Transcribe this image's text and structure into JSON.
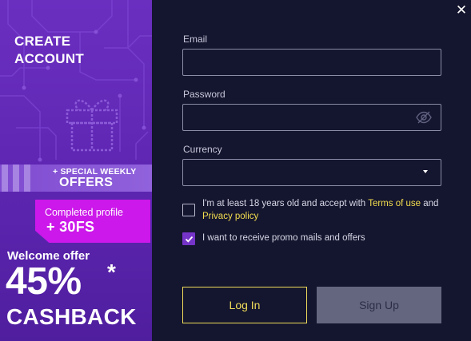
{
  "promo": {
    "title": "CREATE ACCOUNT",
    "weekly_sub": "+ SPECIAL WEEKLY",
    "weekly_main": "OFFERS",
    "profile_sub": "Completed profile",
    "profile_main": "+ 30FS",
    "welcome": "Welcome offer",
    "percent": "45%",
    "asterisk": "*",
    "cashback": "CASHBACK",
    "colors": {
      "panel": "#6027b4",
      "badge": "#cc18ea",
      "band": "#8a58d6"
    }
  },
  "form": {
    "close_label": "✕",
    "email_label": "Email",
    "email_value": "",
    "password_label": "Password",
    "password_value": "",
    "currency_label": "Currency",
    "currency_value": "",
    "icons": {
      "password_toggle": "eye-off-icon",
      "currency_dropdown": "caret-down-icon",
      "close": "close-icon"
    },
    "age_consent": {
      "checked": false,
      "text_before": "I'm at least 18 years old and accept with ",
      "terms_link": "Terms of use",
      "text_middle": " and ",
      "privacy_link": "Privacy policy"
    },
    "promo_consent": {
      "checked": true,
      "text": "I want to receive promo mails and offers"
    },
    "login_label": "Log In",
    "signup_label": "Sign Up",
    "colors": {
      "background": "#14152e",
      "accent": "#f0dc5b",
      "checkbox": "#7534c8"
    }
  }
}
